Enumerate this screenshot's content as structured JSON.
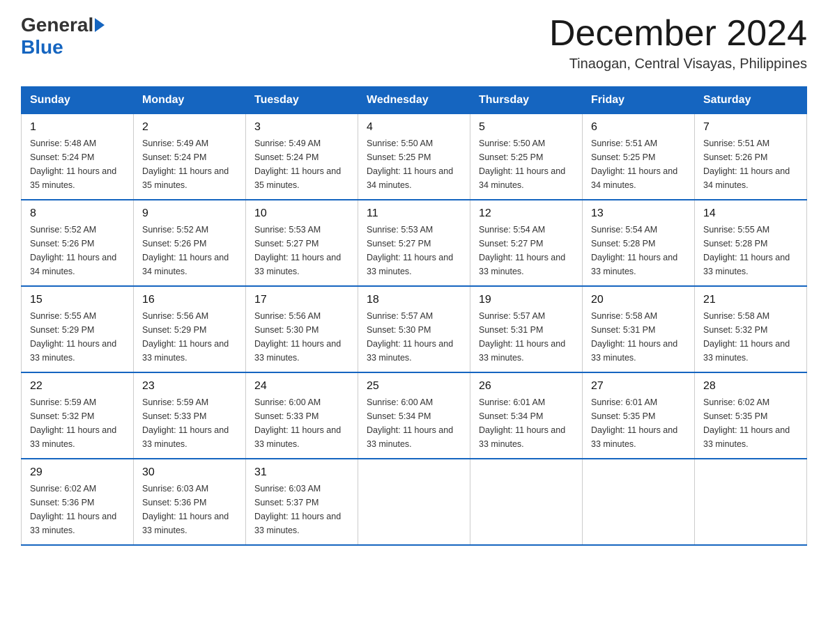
{
  "header": {
    "logo_general": "General",
    "logo_blue": "Blue",
    "month_title": "December 2024",
    "location": "Tinaogan, Central Visayas, Philippines"
  },
  "weekdays": [
    "Sunday",
    "Monday",
    "Tuesday",
    "Wednesday",
    "Thursday",
    "Friday",
    "Saturday"
  ],
  "weeks": [
    [
      {
        "day": "1",
        "sunrise": "5:48 AM",
        "sunset": "5:24 PM",
        "daylight": "11 hours and 35 minutes."
      },
      {
        "day": "2",
        "sunrise": "5:49 AM",
        "sunset": "5:24 PM",
        "daylight": "11 hours and 35 minutes."
      },
      {
        "day": "3",
        "sunrise": "5:49 AM",
        "sunset": "5:24 PM",
        "daylight": "11 hours and 35 minutes."
      },
      {
        "day": "4",
        "sunrise": "5:50 AM",
        "sunset": "5:25 PM",
        "daylight": "11 hours and 34 minutes."
      },
      {
        "day": "5",
        "sunrise": "5:50 AM",
        "sunset": "5:25 PM",
        "daylight": "11 hours and 34 minutes."
      },
      {
        "day": "6",
        "sunrise": "5:51 AM",
        "sunset": "5:25 PM",
        "daylight": "11 hours and 34 minutes."
      },
      {
        "day": "7",
        "sunrise": "5:51 AM",
        "sunset": "5:26 PM",
        "daylight": "11 hours and 34 minutes."
      }
    ],
    [
      {
        "day": "8",
        "sunrise": "5:52 AM",
        "sunset": "5:26 PM",
        "daylight": "11 hours and 34 minutes."
      },
      {
        "day": "9",
        "sunrise": "5:52 AM",
        "sunset": "5:26 PM",
        "daylight": "11 hours and 34 minutes."
      },
      {
        "day": "10",
        "sunrise": "5:53 AM",
        "sunset": "5:27 PM",
        "daylight": "11 hours and 33 minutes."
      },
      {
        "day": "11",
        "sunrise": "5:53 AM",
        "sunset": "5:27 PM",
        "daylight": "11 hours and 33 minutes."
      },
      {
        "day": "12",
        "sunrise": "5:54 AM",
        "sunset": "5:27 PM",
        "daylight": "11 hours and 33 minutes."
      },
      {
        "day": "13",
        "sunrise": "5:54 AM",
        "sunset": "5:28 PM",
        "daylight": "11 hours and 33 minutes."
      },
      {
        "day": "14",
        "sunrise": "5:55 AM",
        "sunset": "5:28 PM",
        "daylight": "11 hours and 33 minutes."
      }
    ],
    [
      {
        "day": "15",
        "sunrise": "5:55 AM",
        "sunset": "5:29 PM",
        "daylight": "11 hours and 33 minutes."
      },
      {
        "day": "16",
        "sunrise": "5:56 AM",
        "sunset": "5:29 PM",
        "daylight": "11 hours and 33 minutes."
      },
      {
        "day": "17",
        "sunrise": "5:56 AM",
        "sunset": "5:30 PM",
        "daylight": "11 hours and 33 minutes."
      },
      {
        "day": "18",
        "sunrise": "5:57 AM",
        "sunset": "5:30 PM",
        "daylight": "11 hours and 33 minutes."
      },
      {
        "day": "19",
        "sunrise": "5:57 AM",
        "sunset": "5:31 PM",
        "daylight": "11 hours and 33 minutes."
      },
      {
        "day": "20",
        "sunrise": "5:58 AM",
        "sunset": "5:31 PM",
        "daylight": "11 hours and 33 minutes."
      },
      {
        "day": "21",
        "sunrise": "5:58 AM",
        "sunset": "5:32 PM",
        "daylight": "11 hours and 33 minutes."
      }
    ],
    [
      {
        "day": "22",
        "sunrise": "5:59 AM",
        "sunset": "5:32 PM",
        "daylight": "11 hours and 33 minutes."
      },
      {
        "day": "23",
        "sunrise": "5:59 AM",
        "sunset": "5:33 PM",
        "daylight": "11 hours and 33 minutes."
      },
      {
        "day": "24",
        "sunrise": "6:00 AM",
        "sunset": "5:33 PM",
        "daylight": "11 hours and 33 minutes."
      },
      {
        "day": "25",
        "sunrise": "6:00 AM",
        "sunset": "5:34 PM",
        "daylight": "11 hours and 33 minutes."
      },
      {
        "day": "26",
        "sunrise": "6:01 AM",
        "sunset": "5:34 PM",
        "daylight": "11 hours and 33 minutes."
      },
      {
        "day": "27",
        "sunrise": "6:01 AM",
        "sunset": "5:35 PM",
        "daylight": "11 hours and 33 minutes."
      },
      {
        "day": "28",
        "sunrise": "6:02 AM",
        "sunset": "5:35 PM",
        "daylight": "11 hours and 33 minutes."
      }
    ],
    [
      {
        "day": "29",
        "sunrise": "6:02 AM",
        "sunset": "5:36 PM",
        "daylight": "11 hours and 33 minutes."
      },
      {
        "day": "30",
        "sunrise": "6:03 AM",
        "sunset": "5:36 PM",
        "daylight": "11 hours and 33 minutes."
      },
      {
        "day": "31",
        "sunrise": "6:03 AM",
        "sunset": "5:37 PM",
        "daylight": "11 hours and 33 minutes."
      },
      null,
      null,
      null,
      null
    ]
  ]
}
